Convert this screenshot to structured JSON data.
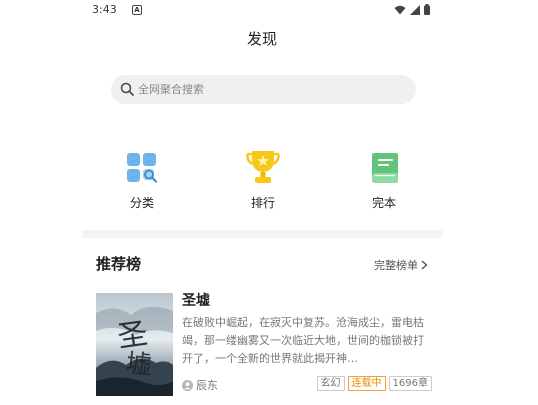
{
  "status_bar": {
    "time": "3:43",
    "notif_badge": "A"
  },
  "header": {
    "title": "发现"
  },
  "search": {
    "placeholder": "全网聚合搜索"
  },
  "quick_nav": [
    {
      "label": "分类",
      "icon": "category-grid-icon",
      "color": "#5aa7e6"
    },
    {
      "label": "排行",
      "icon": "trophy-icon",
      "color": "#f7c81c"
    },
    {
      "label": "完本",
      "icon": "book-icon",
      "color": "#5fc77a"
    }
  ],
  "section": {
    "title": "推荐榜",
    "more": "完整榜单"
  },
  "books": [
    {
      "name": "圣墟",
      "description": "在破败中崛起，在寂灭中复苏。沧海成尘，雷电枯竭，那一缕幽雾又一次临近大地，世间的枷锁被打开了，一个全新的世界就此揭开神…",
      "author": "辰东",
      "tags": [
        "玄幻",
        "连载中",
        "1696章"
      ],
      "cover_title": "圣墟"
    }
  ],
  "colors": {
    "accent_status": "#f08a00",
    "divider": "#f2f3f5"
  }
}
